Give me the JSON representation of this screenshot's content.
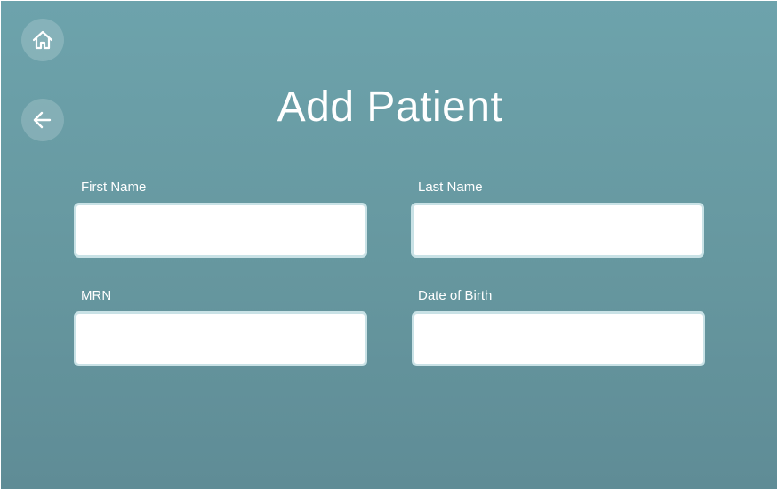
{
  "page": {
    "title": "Add Patient"
  },
  "nav": {
    "home_icon": "home-icon",
    "back_icon": "arrow-left-icon"
  },
  "form": {
    "first_name": {
      "label": "First Name",
      "value": ""
    },
    "last_name": {
      "label": "Last Name",
      "value": ""
    },
    "mrn": {
      "label": "MRN",
      "value": ""
    },
    "date_of_birth": {
      "label": "Date of Birth",
      "value": ""
    }
  },
  "colors": {
    "background_top": "#6da3ac",
    "background_bottom": "#5f8c96",
    "input_border": "#c9e2e6",
    "text": "#ffffff"
  }
}
